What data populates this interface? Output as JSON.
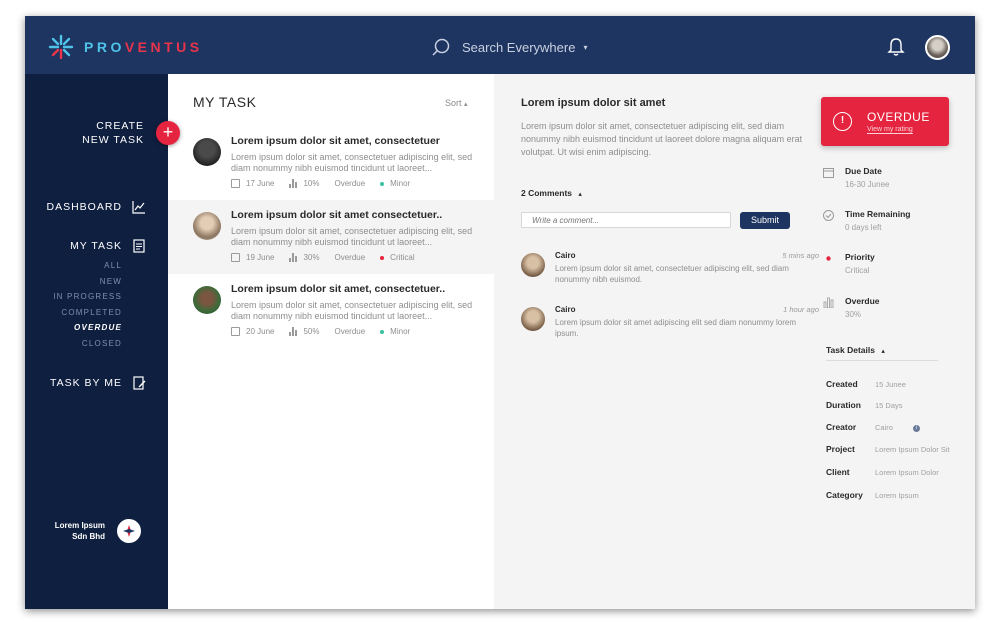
{
  "app": {
    "logo_text": "PROVENTUS"
  },
  "header": {
    "search_label": "Search Everywhere"
  },
  "sidebar": {
    "create_line1": "CREATE",
    "create_line2": "NEW TASK",
    "create_plus": "+",
    "dashboard": "DASHBOARD",
    "my_task": "MY TASK",
    "sub_items": [
      "ALL",
      "NEW",
      "IN PROGRESS",
      "COMPLETED",
      "OVERDUE",
      "CLOSED"
    ],
    "task_by_me": "TASK BY ME",
    "company_line1": "Lorem Ipsum",
    "company_line2": "Sdn Bhd"
  },
  "tasklist": {
    "title": "MY TASK",
    "sort_label": "Sort",
    "tasks": [
      {
        "title": "Lorem ipsum dolor sit amet, consectetuer",
        "desc": "Lorem ipsum dolor sit amet, consectetuer adipiscing elit, sed diam nonummy nibh euismod tincidunt ut laoreet...",
        "date": "17 June",
        "progress": "10%",
        "status": "Overdue",
        "priority": "Minor",
        "priority_color": "#3ac2a0"
      },
      {
        "title": "Lorem ipsum dolor sit amet consectetuer..",
        "desc": "Lorem ipsum dolor sit amet, consectetuer adipiscing elit, sed diam nonummy nibh euismod tincidunt ut laoreet...",
        "date": "19 June",
        "progress": "30%",
        "status": "Overdue",
        "priority": "Critical",
        "priority_color": "#e5253f"
      },
      {
        "title": "Lorem ipsum dolor sit amet, consectetuer..",
        "desc": "Lorem ipsum dolor sit amet, consectetuer adipiscing elit, sed diam nonummy nibh euismod tincidunt ut laoreet...",
        "date": "20 June",
        "progress": "50%",
        "status": "Overdue",
        "priority": "Minor",
        "priority_color": "#3ac2a0"
      }
    ]
  },
  "detail": {
    "title": "Lorem ipsum dolor sit amet",
    "desc": "Lorem ipsum dolor sit amet, consectetuer adipiscing elit, sed diam nonummy nibh euismod tincidunt ut laoreet dolore magna aliquam erat volutpat. Ut wisi enim adipiscing.",
    "comments_label": "2 Comments",
    "comment_placeholder": "Write a comment...",
    "submit_label": "Submit",
    "comments": [
      {
        "name": "Cairo",
        "time": "5 mins ago",
        "text": "Lorem ipsum dolor sit amet, consectetuer adipiscing elit, sed diam nonummy nibh euismod."
      },
      {
        "name": "Cairo",
        "time": "1 hour ago",
        "text": "Lorem ipsum dolor sit amet adipiscing elit sed diam nonummy lorem ipsum."
      }
    ]
  },
  "status_card": {
    "label": "OVERDUE",
    "link": "View my rating"
  },
  "info": {
    "due_date_label": "Due Date",
    "due_date_value": "16-30 Junee",
    "time_label": "Time Remaining",
    "time_value": "0 days left",
    "priority_label": "Priority",
    "priority_value": "Critical",
    "overdue_label": "Overdue",
    "overdue_value": "30%"
  },
  "task_details": {
    "heading": "Task Details",
    "rows": [
      {
        "key": "Created",
        "value": "15 Junee"
      },
      {
        "key": "Duration",
        "value": "15 Days"
      },
      {
        "key": "Creator",
        "value": "Cairo"
      },
      {
        "key": "Project",
        "value": "Lorem Ipsum Dolor Sit"
      },
      {
        "key": "Client",
        "value": "Lorem Ipsum Dolor"
      },
      {
        "key": "Category",
        "value": "Lorem Ipsum"
      }
    ]
  },
  "colors": {
    "header": "#1e3461",
    "sidebar": "#0f1f3f",
    "accent": "#e5253f",
    "minor": "#3ac2a0"
  }
}
